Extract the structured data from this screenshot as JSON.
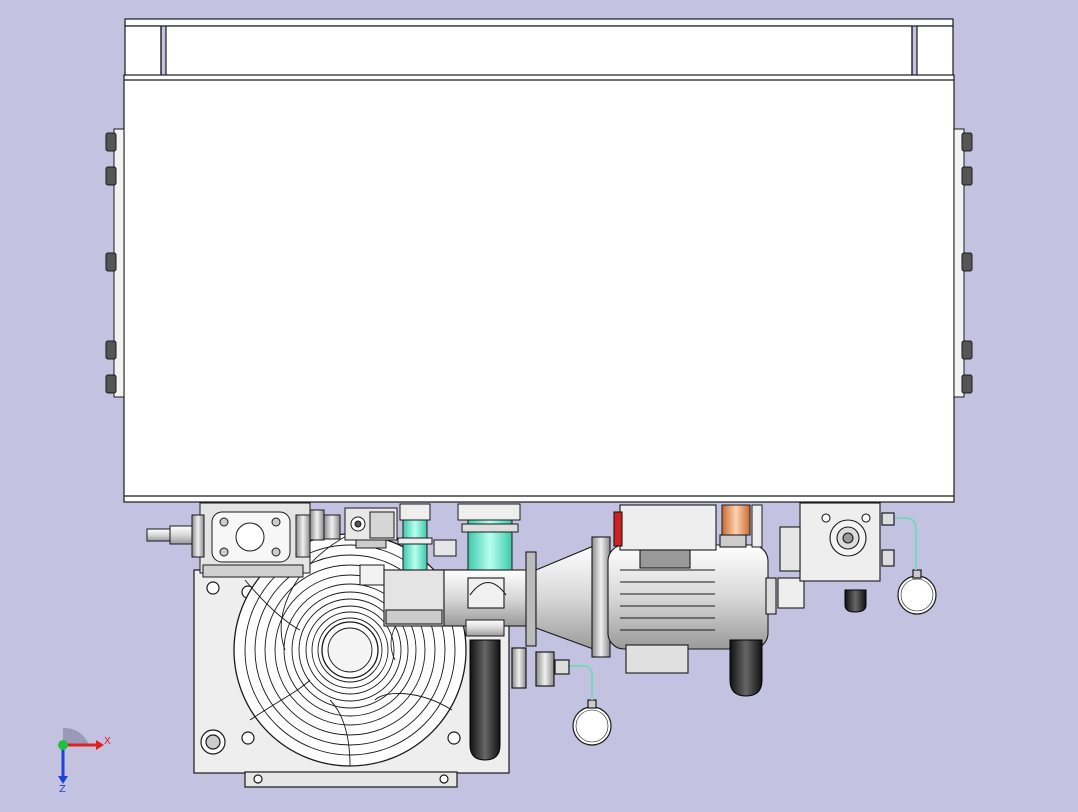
{
  "viewport": {
    "background": "#c3c3e1"
  },
  "triad": {
    "x_label": "X",
    "z_label": "Z",
    "colors": {
      "x": "#e02020",
      "y": "#20c040",
      "z": "#2040e0"
    }
  },
  "colors": {
    "outline": "#1a1a1a",
    "panel": "#ffffff",
    "metal": "#dcdcdc",
    "coolant": "#7fe8d4",
    "copper": "#e8a070",
    "red_accent": "#d02020"
  }
}
